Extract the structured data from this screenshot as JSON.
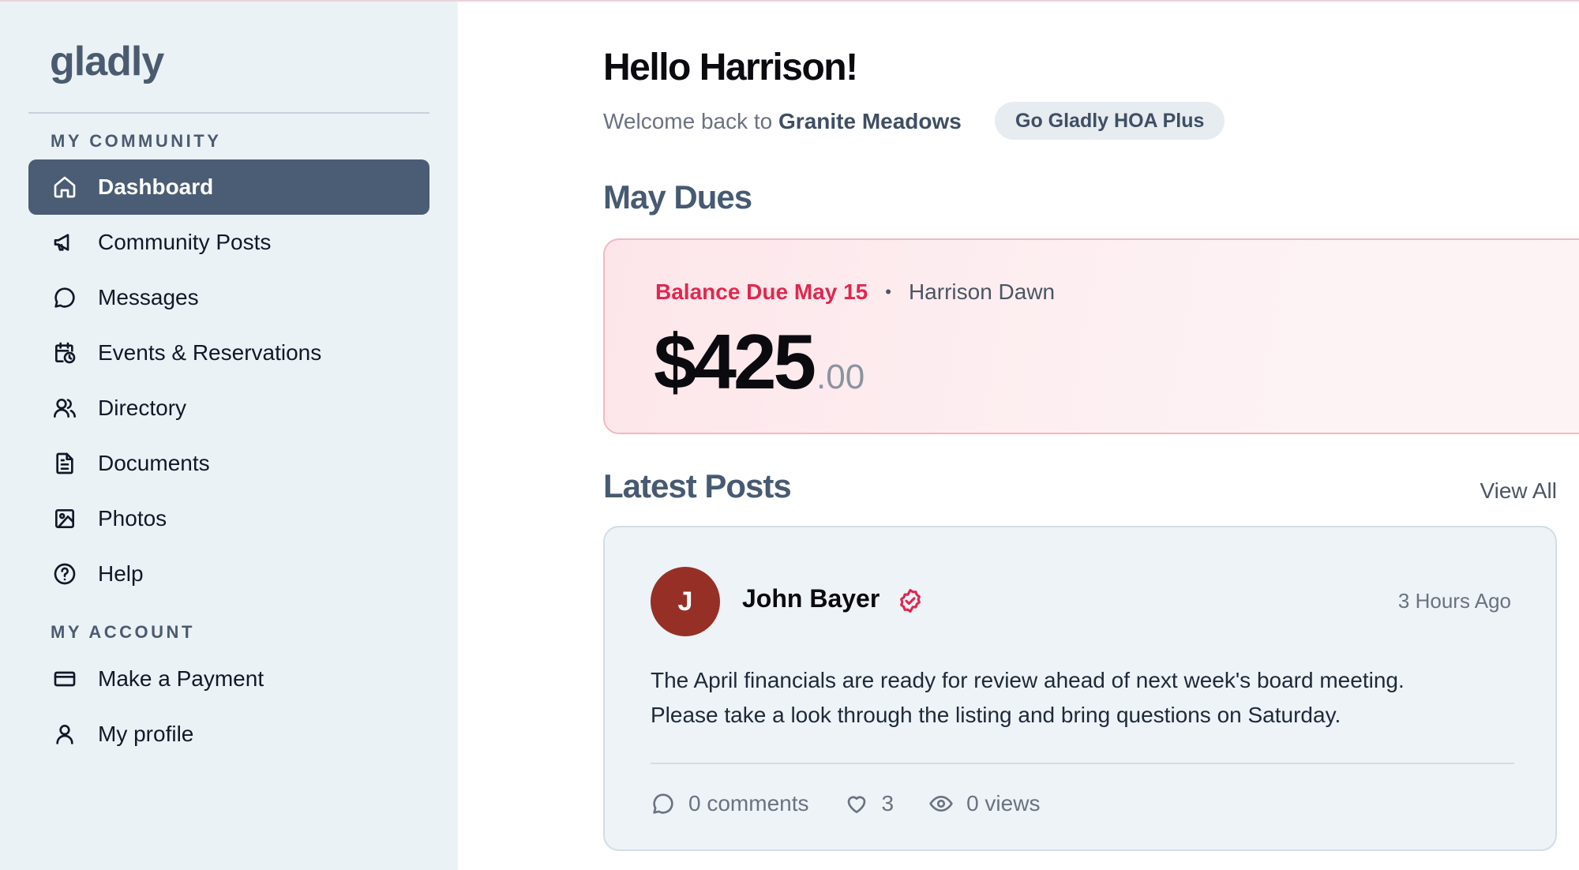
{
  "sidebar": {
    "logo": "gladly",
    "sections": {
      "community_label": "MY COMMUNITY",
      "account_label": "MY ACCOUNT"
    },
    "community_items": [
      {
        "label": "Dashboard",
        "icon": "home-icon",
        "active": true
      },
      {
        "label": "Community Posts",
        "icon": "megaphone-icon"
      },
      {
        "label": "Messages",
        "icon": "chat-bubble-icon"
      },
      {
        "label": "Events & Reservations",
        "icon": "calendar-clock-icon"
      },
      {
        "label": "Directory",
        "icon": "users-icon"
      },
      {
        "label": "Documents",
        "icon": "document-icon"
      },
      {
        "label": "Photos",
        "icon": "image-icon"
      },
      {
        "label": "Help",
        "icon": "help-circle-icon"
      }
    ],
    "account_items": [
      {
        "label": "Make a Payment",
        "icon": "credit-card-icon"
      },
      {
        "label": "My profile",
        "icon": "user-icon"
      }
    ]
  },
  "header": {
    "greeting": "Hello Harrison!",
    "welcome_prefix": "Welcome back to",
    "community_name": "Granite Meadows",
    "plus_button": "Go Gladly HOA Plus"
  },
  "dues": {
    "title": "May Dues",
    "due_label": "Balance Due May 15",
    "separator": "•",
    "resident": "Harrison Dawn",
    "amount_whole": "$425",
    "amount_cents": ".00"
  },
  "posts": {
    "title": "Latest Posts",
    "view_all": "View All",
    "items": [
      {
        "avatar_initial": "J",
        "author": "John Bayer",
        "verified_icon": "verified-badge-icon",
        "time": "3 Hours Ago",
        "body_line1": "The April financials are ready for review ahead of next week's board meeting.",
        "body_line2": "Please take a look through the listing and bring questions on Saturday.",
        "comments": "0 comments",
        "likes": "3",
        "views": "0 views"
      }
    ]
  },
  "colors": {
    "sidebar_bg": "#ebf2f6",
    "active_nav": "#4b5d74",
    "accent_red": "#e0284f",
    "heading_slate": "#475a72",
    "avatar_bg": "#963026"
  }
}
